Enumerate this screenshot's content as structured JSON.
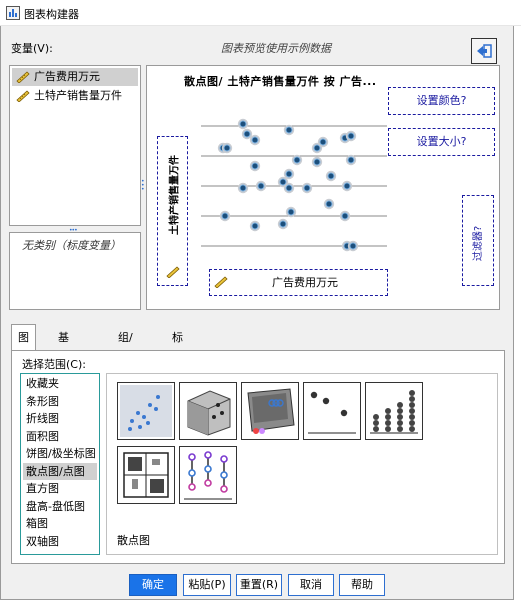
{
  "window": {
    "title": "图表构建器"
  },
  "variables": {
    "label": "变量(V):",
    "items": [
      {
        "label": "广告费用万元",
        "selected": true
      },
      {
        "label": "土特产销售量万件",
        "selected": false
      }
    ]
  },
  "preview_note": "图表预览使用示例数据",
  "categories_note": "无类别（标度变量）",
  "canvas": {
    "chart_title": "散点图/ 土特产销售量万件 按 广告...",
    "set_color": "设置颜色?",
    "set_size": "设置大小?",
    "filter": "过滤器?",
    "y_axis": "土特产销售量万件",
    "x_axis": "广告费用万元"
  },
  "tabs": [
    {
      "label": "图库",
      "active": true
    },
    {
      "label": "基本元素",
      "active": false
    },
    {
      "label": "组/点 ID",
      "active": false
    },
    {
      "label": "标题/脚注",
      "active": false
    }
  ],
  "gallery": {
    "choose_label": "选择范围(C):",
    "types": [
      "收藏夹",
      "条形图",
      "折线图",
      "面积图",
      "饼图/极坐标图",
      "散点图/点图",
      "直方图",
      "盘高-盘低图",
      "箱图",
      "双轴图"
    ],
    "selected_type": "散点图/点图",
    "caption": "散点图",
    "thumbs": [
      "simple-scatter-thumb-icon",
      "3d-scatter-thumb-icon",
      "grouped-3d-scatter-thumb-icon",
      "simple-dot-thumb-icon",
      "dot-column-thumb-icon",
      "scatterplot-matrix-thumb-icon",
      "drop-line-thumb-icon"
    ]
  },
  "buttons": {
    "ok": "确定",
    "paste": "粘贴(P)",
    "reset": "重置(R)",
    "cancel": "取消",
    "help": "帮助"
  },
  "colors": {
    "accent": "#1a73e8",
    "drop_border": "#1a1aa0",
    "point": "#1c4f7c"
  }
}
